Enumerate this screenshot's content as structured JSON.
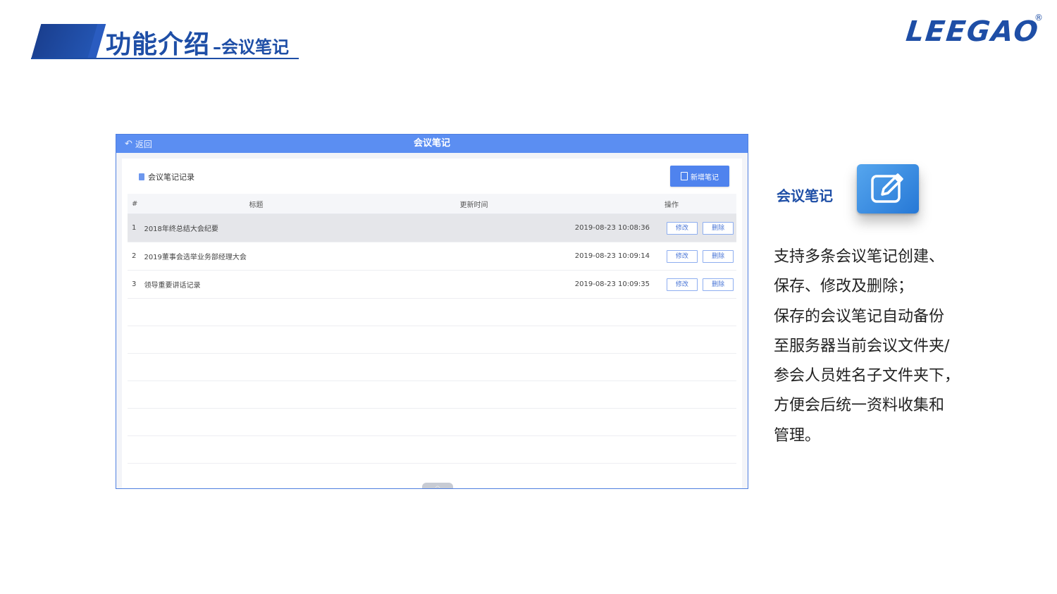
{
  "slide": {
    "title_main": "功能介绍",
    "title_sub": "–会议笔记",
    "brand": "LEEGAO",
    "brand_reg": "®"
  },
  "app": {
    "back_label": "返回",
    "window_title": "会议笔记",
    "section_label": "会议笔记记录",
    "add_button": "新增笔记",
    "columns": [
      "#",
      "标题",
      "更新时间",
      "操作"
    ],
    "rows": [
      {
        "idx": "1",
        "title": "2018年终总结大会纪要",
        "time": "2019-08-23 10:08:36",
        "edit": "修改",
        "delete": "删除"
      },
      {
        "idx": "2",
        "title": "2019董事会选举业务部经理大会",
        "time": "2019-08-23 10:09:14",
        "edit": "修改",
        "delete": "删除"
      },
      {
        "idx": "3",
        "title": "领导重要讲话记录",
        "time": "2019-08-23 10:09:35",
        "edit": "修改",
        "delete": "删除"
      }
    ]
  },
  "feature": {
    "label": "会议笔记",
    "icon": "edit-note-icon",
    "lines": [
      "支持多条会议笔记创建、",
      "保存、修改及删除；",
      "保存的会议笔记自动备份",
      "至服务器当前会议文件夹/",
      "参会人员姓名子文件夹下，",
      "方便会后统一资料收集和",
      "管理。"
    ]
  },
  "colors": {
    "brand_blue": "#1e4ea6",
    "titlebar": "#5b8ef2",
    "button": "#4f83ee"
  }
}
